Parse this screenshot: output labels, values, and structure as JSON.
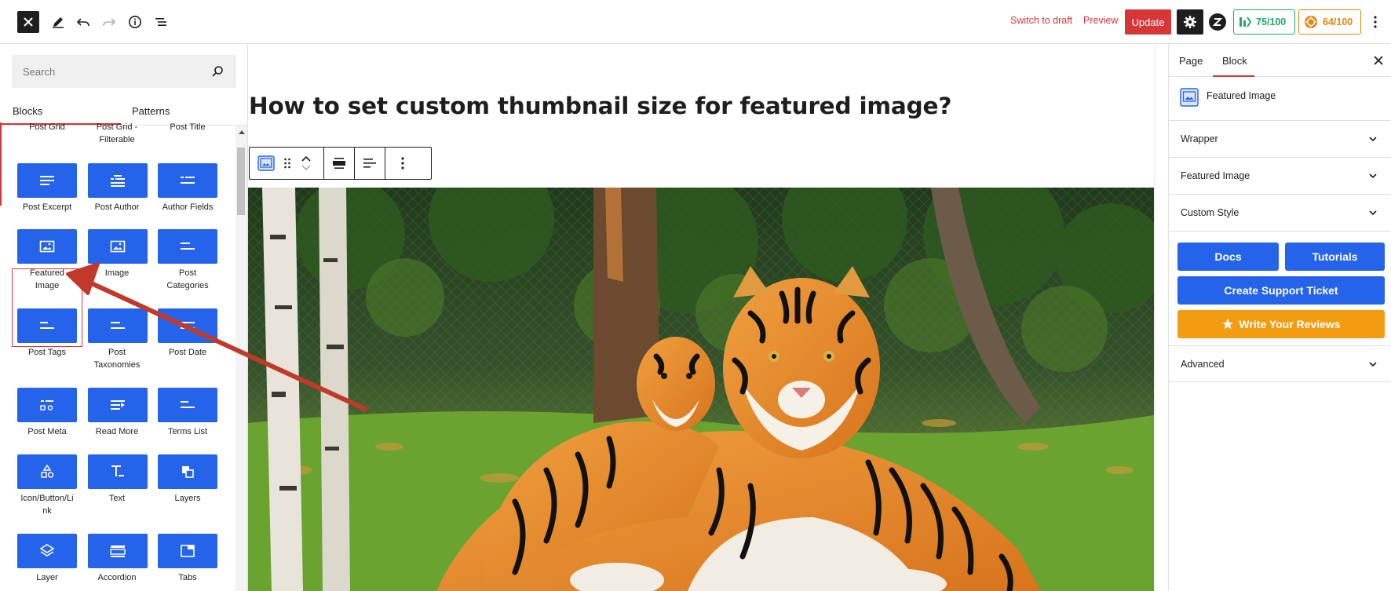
{
  "topbar": {
    "switch_to_draft": "Switch to draft",
    "preview": "Preview",
    "update": "Update",
    "seo_score": "75/100",
    "readability_score": "64/100",
    "colors": {
      "danger": "#d63638",
      "seo_green": "#1fa868",
      "score_orange": "#e8850c"
    }
  },
  "inserter": {
    "search_placeholder": "Search",
    "tabs": [
      "Blocks",
      "Patterns"
    ],
    "blocks_partial": [
      "Post Grid",
      "Post Grid -\nFilterable",
      "Post Title"
    ],
    "blocks": [
      {
        "label": "Post Excerpt",
        "icon": "excerpt-icon"
      },
      {
        "label": "Post Author",
        "icon": "author-icon"
      },
      {
        "label": "Author Fields",
        "icon": "author-fields-icon"
      },
      {
        "label": "Featured\nImage",
        "icon": "featured-image-icon"
      },
      {
        "label": "Image",
        "icon": "image-icon"
      },
      {
        "label": "Post\nCategories",
        "icon": "categories-icon"
      },
      {
        "label": "Post Tags",
        "icon": "tags-icon"
      },
      {
        "label": "Post\nTaxonomies",
        "icon": "taxonomies-icon"
      },
      {
        "label": "Post Date",
        "icon": "date-icon"
      },
      {
        "label": "Post Meta",
        "icon": "meta-icon"
      },
      {
        "label": "Read More",
        "icon": "read-more-icon"
      },
      {
        "label": "Terms List",
        "icon": "terms-list-icon"
      },
      {
        "label": "Icon/Button/Li\nnk",
        "icon": "icon-button-link-icon"
      },
      {
        "label": "Text",
        "icon": "text-icon"
      },
      {
        "label": "Layers",
        "icon": "layers-icon"
      },
      {
        "label": "Layer",
        "icon": "layer-icon"
      },
      {
        "label": "Accordion",
        "icon": "accordion-icon"
      },
      {
        "label": "Tabs",
        "icon": "tabs-icon"
      }
    ],
    "accent": "#2563eb"
  },
  "canvas": {
    "post_title": "How to set custom thumbnail size for featured image?"
  },
  "sidebar": {
    "tabs": [
      "Page",
      "Block"
    ],
    "selected_block": "Featured Image",
    "panels": [
      "Wrapper",
      "Featured Image",
      "Custom Style"
    ],
    "buttons": {
      "docs": "Docs",
      "tutorials": "Tutorials",
      "support": "Create Support Ticket",
      "reviews": "Write Your Reviews"
    },
    "advanced": "Advanced"
  }
}
